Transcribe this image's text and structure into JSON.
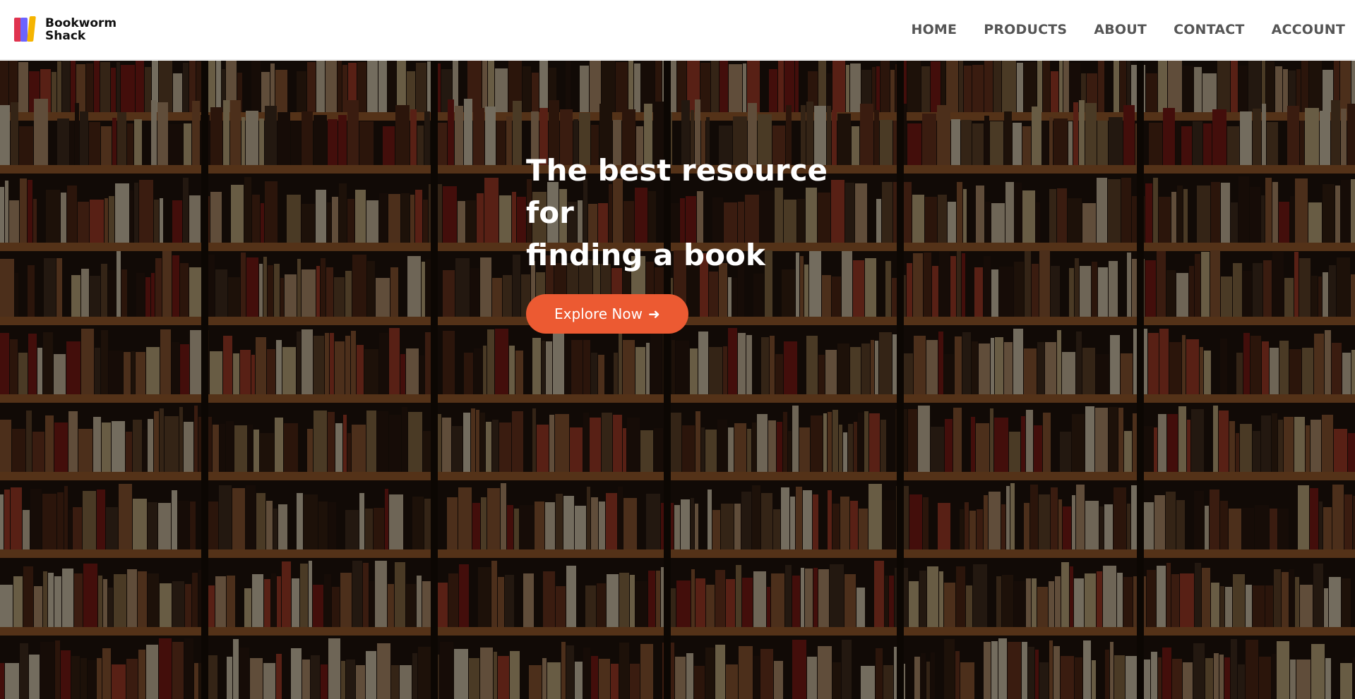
{
  "brand": {
    "name_line1": "Bookworm",
    "name_line2": "Shack"
  },
  "nav": {
    "items": [
      {
        "label": "HOME"
      },
      {
        "label": "PRODUCTS"
      },
      {
        "label": "ABOUT"
      },
      {
        "label": "CONTACT"
      },
      {
        "label": "ACCOUNT"
      }
    ]
  },
  "hero": {
    "title_line1": "The best resource for",
    "title_line2": "finding a book",
    "cta_label": "Explore Now",
    "cta_arrow": "➜"
  },
  "colors": {
    "accent": "#ec5a32",
    "nav_text": "#555555",
    "logo_red": "#e0334f",
    "logo_purple": "#6c63ff",
    "logo_yellow": "#f5b400"
  },
  "icons": {
    "logo": "books-logo-icon",
    "cta": "arrow-right-icon"
  }
}
